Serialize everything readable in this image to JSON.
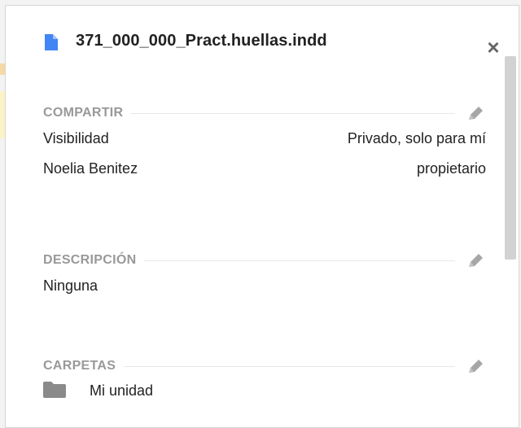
{
  "file": {
    "name": "371_000_000_Pract.huellas.indd",
    "icon": "google-doc-icon",
    "icon_color": "#4285f4"
  },
  "close_label": "×",
  "sharing": {
    "title": "COMPARTIR",
    "rows": [
      {
        "label": "Visibilidad",
        "value": "Privado, solo para mí"
      },
      {
        "label": "Noelia Benitez",
        "value": "propietario"
      }
    ]
  },
  "description": {
    "title": "DESCRIPCIÓN",
    "text": "Ninguna"
  },
  "folders": {
    "title": "CARPETAS",
    "items": [
      {
        "label": "Mi unidad",
        "icon": "folder-icon"
      }
    ]
  },
  "colors": {
    "section_title": "#999999",
    "text": "#222222",
    "icon_gray": "#a6a6a6"
  }
}
